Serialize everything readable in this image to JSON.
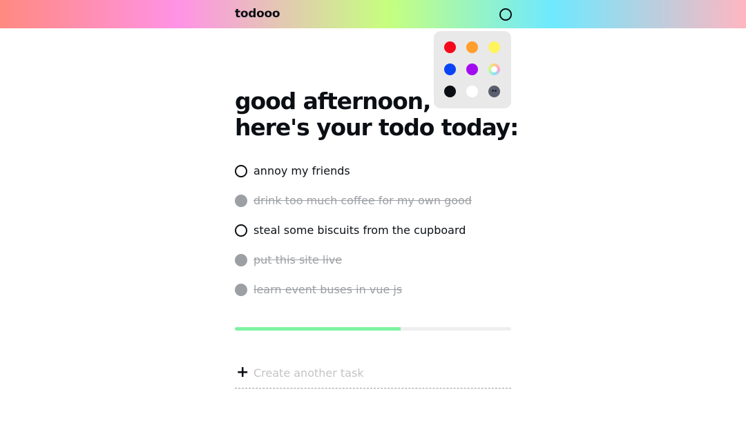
{
  "header": {
    "brand": "todooo",
    "theme_toggle_icon": "circle-icon"
  },
  "palette": {
    "swatches": [
      {
        "name": "red",
        "color": "#f5091c"
      },
      {
        "name": "orange",
        "color": "#ff9e2a"
      },
      {
        "name": "yellow",
        "color": "#fff35e"
      },
      {
        "name": "blue",
        "color": "#0a45f5"
      },
      {
        "name": "purple",
        "color": "#a20bf0"
      },
      {
        "name": "rainbow",
        "color": "#ffd27e"
      },
      {
        "name": "black",
        "color": "#0b0f14"
      },
      {
        "name": "white",
        "color": "#ffffff"
      },
      {
        "name": "dark-moon",
        "color": "#5a5e6e"
      }
    ]
  },
  "greeting": {
    "line1": "good afternoon,",
    "line2": "here's your todo today:"
  },
  "tasks": [
    {
      "label": "annoy my friends",
      "done": false
    },
    {
      "label": "drink too much coffee for my own good",
      "done": true
    },
    {
      "label": "steal some biscuits from the cupboard",
      "done": false
    },
    {
      "label": "put this site live",
      "done": true
    },
    {
      "label": "learn event buses in vue js",
      "done": true
    }
  ],
  "progress": {
    "fraction": 0.6,
    "fill_color": "#7ef3a1"
  },
  "new_task": {
    "icon": "plus-icon",
    "plus_symbol": "+",
    "placeholder": "Create another task",
    "value": ""
  }
}
